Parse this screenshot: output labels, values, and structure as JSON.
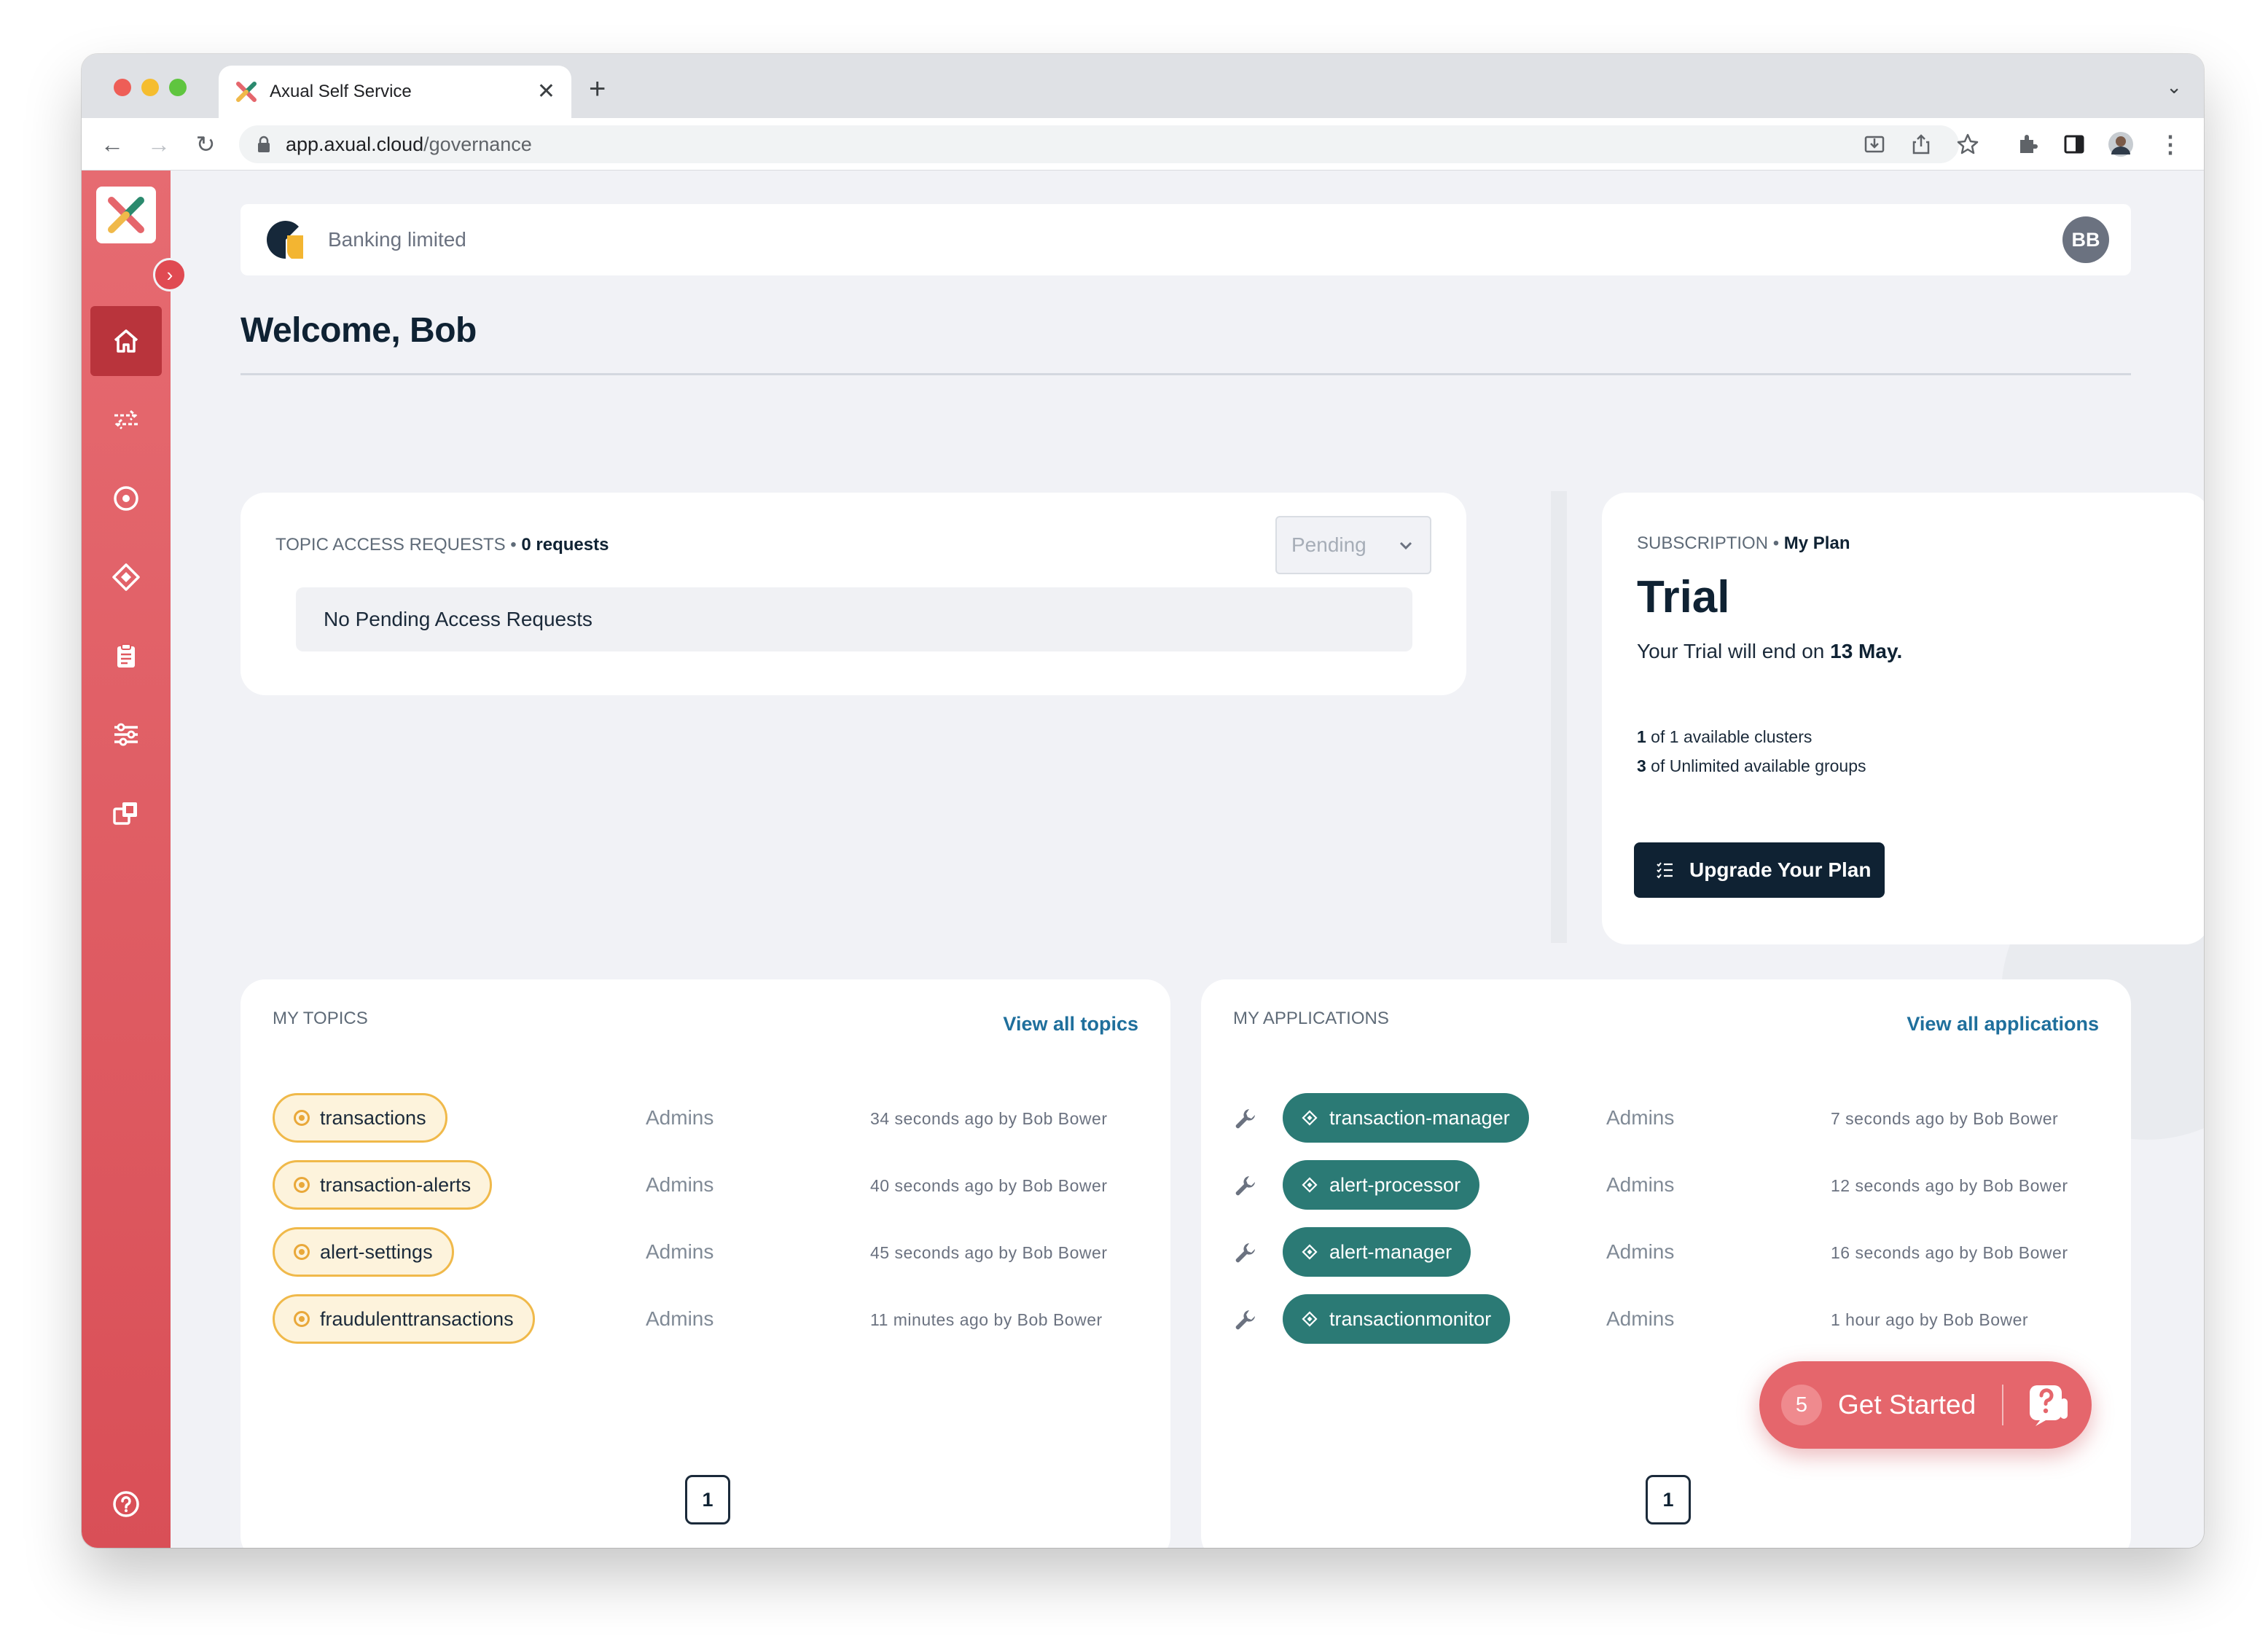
{
  "browser": {
    "tab_title": "Axual Self Service",
    "url_host": "app.axual.cloud",
    "url_path": "/governance"
  },
  "header": {
    "company_name": "Banking limited",
    "avatar_initials": "BB"
  },
  "page": {
    "welcome": "Welcome, Bob"
  },
  "access_requests": {
    "label": "TOPIC ACCESS REQUESTS",
    "separator": " • ",
    "count": "0 requests",
    "filter_value": "Pending",
    "empty_message": "No Pending Access Requests"
  },
  "subscription": {
    "label": "SUBSCRIPTION",
    "separator": " • ",
    "plan_label": "My Plan",
    "title": "Trial",
    "trial_text": "Your Trial will end on ",
    "trial_date": "13 May.",
    "clusters_count": "1",
    "clusters_text": " of 1 available clusters",
    "groups_count": "3",
    "groups_text": " of Unlimited available groups",
    "upgrade_label": "Upgrade Your Plan"
  },
  "topics": {
    "title": "MY TOPICS",
    "view_all": "View all topics",
    "page": "1",
    "rows": [
      {
        "name": "transactions",
        "owner": "Admins",
        "meta": "34 seconds ago by Bob Bower"
      },
      {
        "name": "transaction-alerts",
        "owner": "Admins",
        "meta": "40 seconds ago by Bob Bower"
      },
      {
        "name": "alert-settings",
        "owner": "Admins",
        "meta": "45 seconds ago by Bob Bower"
      },
      {
        "name": "fraudulenttransactions",
        "owner": "Admins",
        "meta": "11 minutes ago by Bob Bower"
      }
    ]
  },
  "applications": {
    "title": "MY APPLICATIONS",
    "view_all": "View all applications",
    "page": "1",
    "rows": [
      {
        "name": "transaction-manager",
        "owner": "Admins",
        "meta": "7 seconds ago by Bob Bower"
      },
      {
        "name": "alert-processor",
        "owner": "Admins",
        "meta": "12 seconds ago by Bob Bower"
      },
      {
        "name": "alert-manager",
        "owner": "Admins",
        "meta": "16 seconds ago by Bob Bower"
      },
      {
        "name": "transactionmonitor",
        "owner": "Admins",
        "meta": "1 hour ago by Bob Bower"
      }
    ]
  },
  "get_started": {
    "badge": "5",
    "label": "Get Started"
  },
  "colors": {
    "sidebar": "#e0595f",
    "navy": "#0f2233",
    "topic_pill_border": "#f0b94a",
    "app_pill": "#2b7a75",
    "link": "#1f6f9c"
  },
  "icons": {
    "sidebar": [
      "home-icon",
      "streams-icon",
      "topics-icon",
      "applications-icon",
      "clipboard-icon",
      "settings-sliders-icon",
      "environments-icon",
      "help-icon"
    ]
  }
}
